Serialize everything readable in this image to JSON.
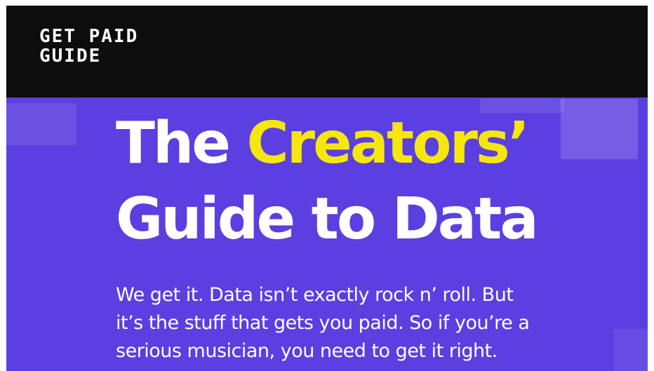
{
  "header": {
    "logo_line_1": "GET PAID",
    "logo_line_2": "GUIDE"
  },
  "hero": {
    "title_part_1": "The ",
    "title_accent": "Creators’",
    "title_line_2": "Guide to Data",
    "lead_line_1": "We get it. Data isn’t exactly rock n’ roll. But",
    "lead_line_2": "it’s the stuff that gets you paid. So if you’re a",
    "lead_line_3": "serious musician, you need to get it right."
  },
  "colors": {
    "header_bg": "#0d0d0d",
    "hero_bg": "#5b3fe0",
    "accent": "#f5e70d",
    "text": "#ffffff"
  }
}
